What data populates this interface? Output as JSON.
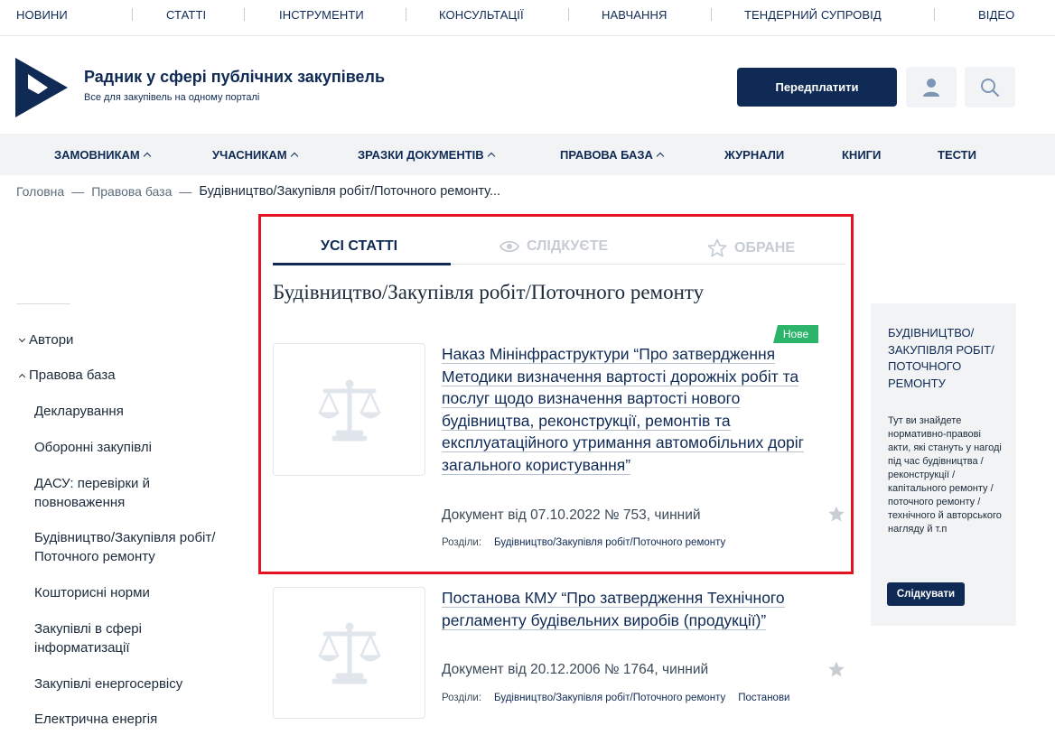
{
  "topnav": {
    "items": [
      "НОВИНИ",
      "СТАТТІ",
      "ІНСТРУМЕНТИ",
      "КОНСУЛЬТАЦІЇ",
      "НАВЧАННЯ",
      "ТЕНДЕРНИЙ СУПРОВІД",
      "ВІДЕО"
    ]
  },
  "header": {
    "title": "Радник у сфері публічних закупівель",
    "subtitle": "Все для закупівель на одному порталі",
    "subscribe_label": "Передплатити",
    "user_icon": "user-icon",
    "search_icon": "search-icon"
  },
  "mainmenu": {
    "items": [
      "ЗАМОВНИКАМ",
      "УЧАСНИКАМ",
      "ЗРАЗКИ ДОКУМЕНТІВ",
      "ПРАВОВА БАЗА",
      "ЖУРНАЛИ",
      "КНИГИ",
      "ТЕСТИ"
    ]
  },
  "breadcrumb": {
    "items": [
      "Головна",
      "Правова база"
    ],
    "separator": "—",
    "current": "Будівництво/Закупівля робіт/Поточного ремонту..."
  },
  "sidebar": {
    "items": [
      "Автори",
      "Правова база",
      "Декларування",
      "Оборонні закупівлі",
      "ДАСУ: перевірки й повноваження",
      "Будівництво/Закупівля робіт/ Поточного ремонту",
      "Кошторисні норми",
      "Закупівлі в сфері інформатизації",
      "Закупівлі енергосервісу",
      "Електрична енергія"
    ]
  },
  "tabs": {
    "all": "УСІ СТАТТІ",
    "following": "СЛІДКУЄТЕ",
    "favorites": "ОБРАНЕ"
  },
  "section_title": "Будівництво/Закупівля робіт/Поточного ремонту",
  "articles": [
    {
      "badge": "Нове",
      "title": "Наказ Мінінфраструктури “Про затвердження Методики визначення вартості дорожніх робіт та послуг щодо визначення вартості нового будівництва, реконструкції, ремонтів та експлуатаційного утримання автомобільних доріг загального користування”",
      "meta": "Документ від 07.10.2022 № 753, чинний",
      "sections_label": "Розділи:",
      "sections": [
        "Будівництво/Закупівля робіт/Поточного ремонту"
      ]
    },
    {
      "title": "Постанова КМУ “Про затвердження Технічного регламенту будівельних виробів (продукції)”",
      "meta": "Документ від 20.12.2006 № 1764, чинний",
      "sections_label": "Розділи:",
      "sections": [
        "Будівництво/Закупівля робіт/Поточного ремонту",
        "Постанови"
      ]
    }
  ],
  "right_panel": {
    "title": "БУДІВНИЦТВО/ ЗАКУПІВЛЯ РОБІТ/ ПОТОЧНОГО РЕМОНТУ",
    "text": "Тут ви знайдете нормативно-правові акти, які стануть у нагоді під час будівництва / реконструкції / капітального ремонту / поточного ремонту / технічного й авторського нагляду й т.п",
    "button": "Слідкувати"
  },
  "colors": {
    "brand": "#0f2a55",
    "highlight": "#e3141f",
    "badge": "#2db46b"
  }
}
